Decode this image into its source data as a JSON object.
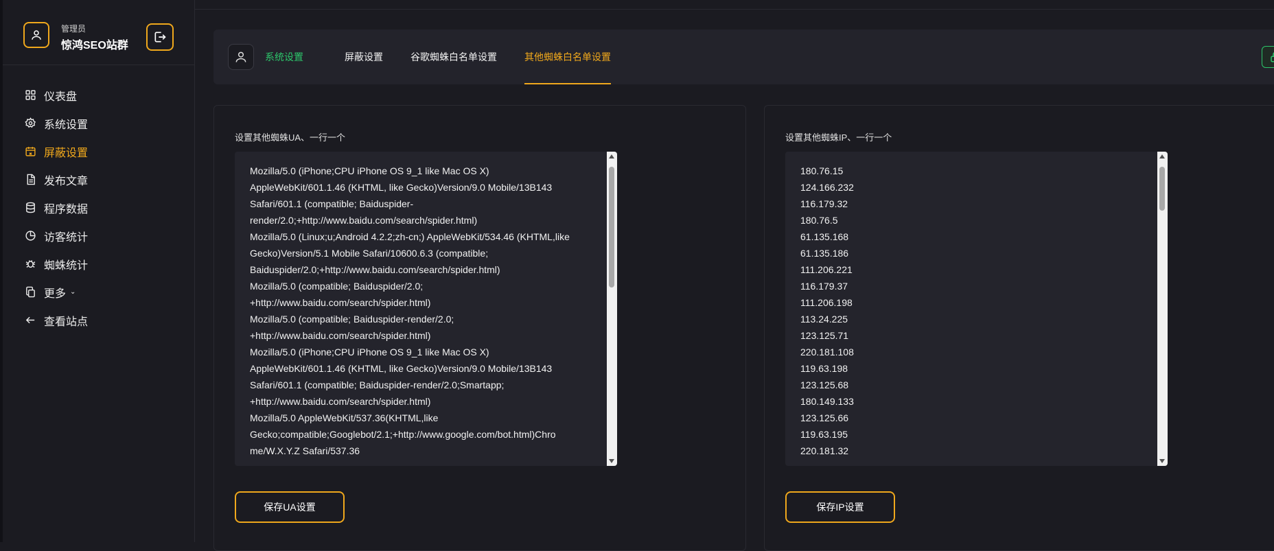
{
  "user": {
    "role": "管理员",
    "name": "惊鸿SEO站群"
  },
  "nav": [
    {
      "label": "仪表盘",
      "icon": "dashboard-icon"
    },
    {
      "label": "系统设置",
      "icon": "gear-icon"
    },
    {
      "label": "屏蔽设置",
      "icon": "calendar-block-icon",
      "active": true
    },
    {
      "label": "发布文章",
      "icon": "document-icon"
    },
    {
      "label": "程序数据",
      "icon": "database-icon"
    },
    {
      "label": "访客统计",
      "icon": "pie-chart-icon"
    },
    {
      "label": "蜘蛛统计",
      "icon": "bug-icon"
    },
    {
      "label": "更多",
      "icon": "copy-icon",
      "caret": "⌄"
    },
    {
      "label": "查看站点",
      "icon": "arrow-left-icon"
    }
  ],
  "tabs": [
    {
      "label": "系统设置",
      "state": "green"
    },
    {
      "label": "屏蔽设置",
      "state": "normal"
    },
    {
      "label": "谷歌蜘蛛白名单设置",
      "state": "normal"
    },
    {
      "label": "其他蜘蛛白名单设置",
      "state": "active"
    }
  ],
  "ua_panel": {
    "label": "设置其他蜘蛛UA、一行一个",
    "content": "Mozilla/5.0 (iPhone;CPU iPhone OS 9_1 like Mac OS X)\nAppleWebKit/601.1.46 (KHTML, like Gecko)Version/9.0 Mobile/13B143\nSafari/601.1 (compatible; Baiduspider-\nrender/2.0;+http://www.baidu.com/search/spider.html)\nMozilla/5.0 (Linux;u;Android 4.2.2;zh-cn;) AppleWebKit/534.46 (KHTML,like\nGecko)Version/5.1 Mobile Safari/10600.6.3 (compatible;\nBaiduspider/2.0;+http://www.baidu.com/search/spider.html)\nMozilla/5.0 (compatible; Baiduspider/2.0;\n+http://www.baidu.com/search/spider.html)\nMozilla/5.0 (compatible; Baiduspider-render/2.0;\n +http://www.baidu.com/search/spider.html)\nMozilla/5.0 (iPhone;CPU iPhone OS 9_1 like Mac OS X)\nAppleWebKit/601.1.46 (KHTML, like Gecko)Version/9.0 Mobile/13B143\nSafari/601.1 (compatible; Baiduspider-render/2.0;Smartapp;\n+http://www.baidu.com/search/spider.html)\nMozilla/5.0 AppleWebKit/537.36(KHTML,like\nGecko;compatible;Googlebot/2.1;+http://www.google.com/bot.html)Chro\nme/W.X.Y.Z Safari/537.36",
    "button": "保存UA设置"
  },
  "ip_panel": {
    "label": "设置其他蜘蛛IP、一行一个",
    "content": "180.76.15\n124.166.232\n116.179.32\n180.76.5\n61.135.168\n61.135.186\n111.206.221\n116.179.37\n111.206.198\n113.24.225\n123.125.71\n220.181.108\n119.63.198\n123.125.68\n180.149.133\n123.125.66\n119.63.195\n220.181.32",
    "button": "保存IP设置"
  },
  "colors": {
    "accent": "#f0a81c",
    "green": "#2dc66b",
    "background": "#1b1b21",
    "card": "#23232b"
  }
}
